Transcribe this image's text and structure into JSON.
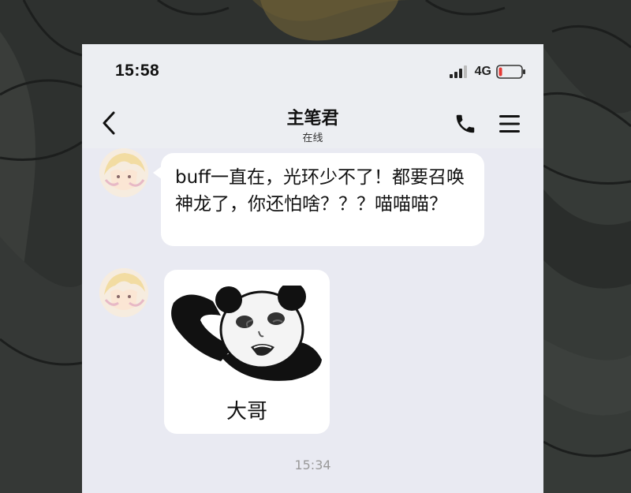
{
  "status_bar": {
    "time": "15:58",
    "network": "4G",
    "battery_level": 0.15,
    "battery_color": "#e53935"
  },
  "header": {
    "back_icon": "chevron-left-icon",
    "title": "主笔君",
    "subtitle": "在线",
    "call_icon": "phone-icon",
    "menu_icon": "menu-icon"
  },
  "messages": [
    {
      "type": "text",
      "text": "buff一直在，光环少不了！都要召唤神龙了，你还怕啥？？？喵喵喵？"
    },
    {
      "type": "sticker",
      "sticker_icon": "panda-meme-sticker",
      "caption": "大哥"
    }
  ],
  "timestamp": "15:34",
  "colors": {
    "chat_bg": "#e9eaf2",
    "bubble_bg": "#ffffff",
    "timestamp_color": "#999999"
  }
}
